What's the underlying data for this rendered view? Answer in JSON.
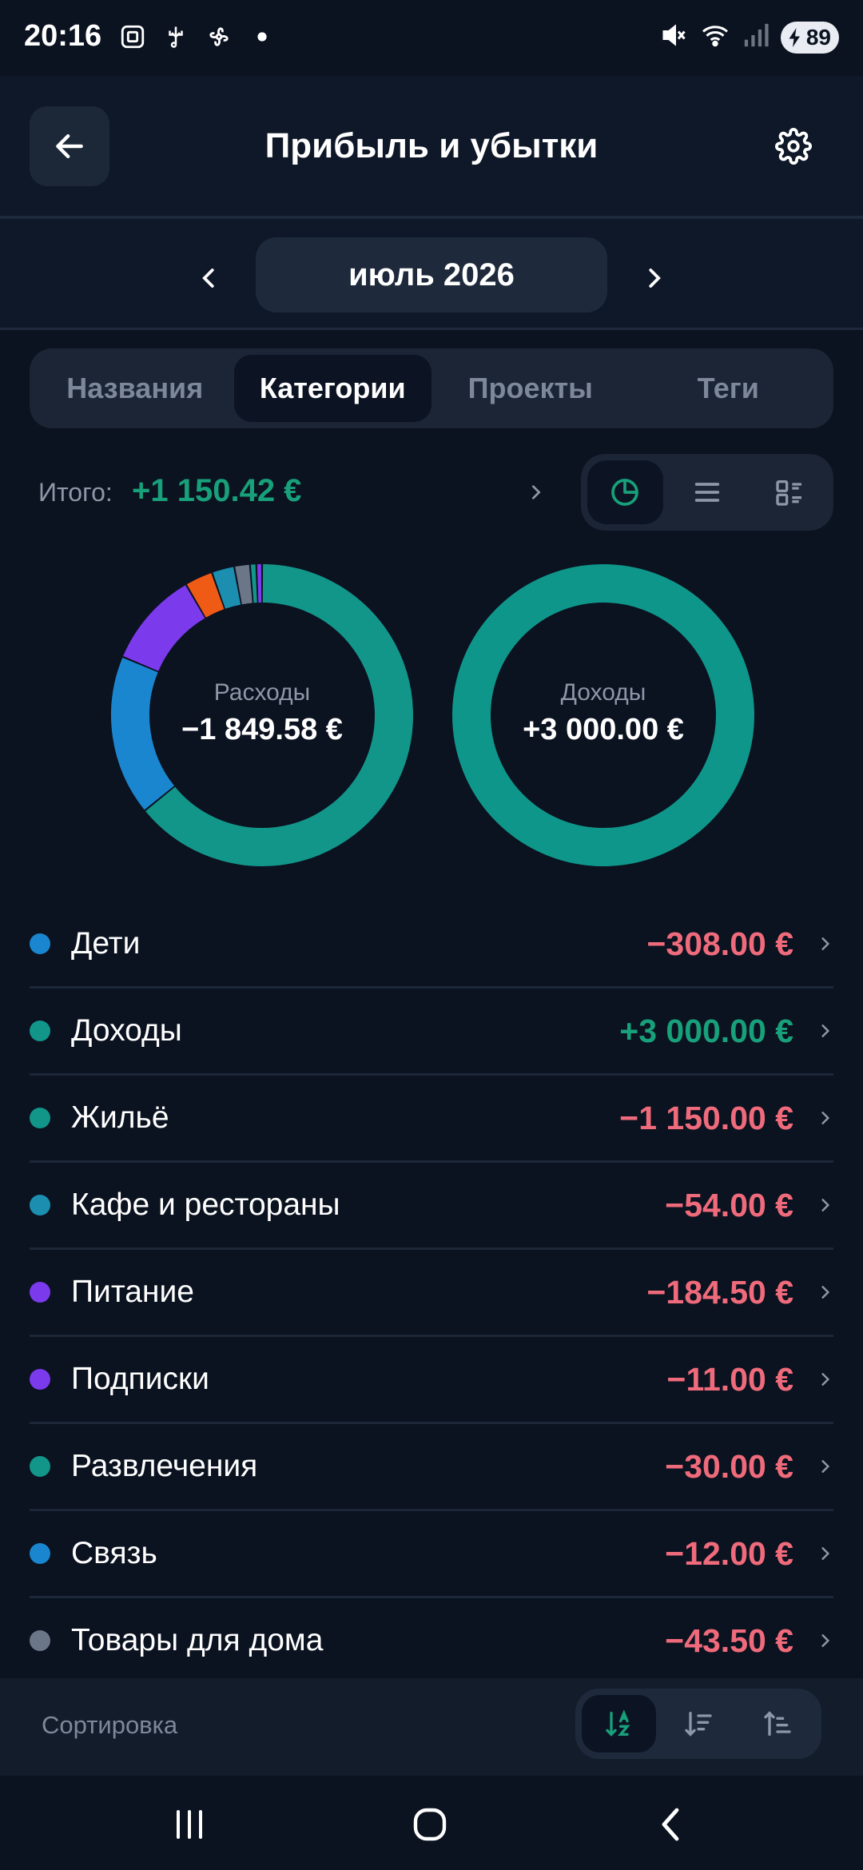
{
  "status_bar": {
    "time": "20:16",
    "battery": "89",
    "icons": [
      "screenshot-icon",
      "usb-icon",
      "fan-icon",
      "dot-icon",
      "mute-icon",
      "wifi-icon",
      "signal-icon",
      "battery-icon"
    ]
  },
  "header": {
    "title": "Прибыль и убытки",
    "back_icon": "arrow-left-icon",
    "settings_icon": "gear-icon"
  },
  "period": {
    "label": "июль 2026"
  },
  "tabs": [
    {
      "label": "Названия",
      "active": false
    },
    {
      "label": "Категории",
      "active": true
    },
    {
      "label": "Проекты",
      "active": false
    },
    {
      "label": "Теги",
      "active": false
    }
  ],
  "total": {
    "label": "Итого:",
    "value": "+1 150.42 €"
  },
  "view_modes": [
    "pie-chart-icon",
    "list-icon",
    "grid-list-icon"
  ],
  "charts": {
    "expenses": {
      "label": "Расходы",
      "value": "−1 849.58 €"
    },
    "income": {
      "label": "Доходы",
      "value": "+3 000.00 €"
    }
  },
  "chart_data": [
    {
      "type": "pie",
      "title": "Расходы",
      "categories": [
        "Жильё",
        "Дети",
        "Питание",
        "Кафе и рестораны",
        "Товары для дома",
        "Развлечения",
        "Связь",
        "Подписки"
      ],
      "values": [
        1150.0,
        308.0,
        184.5,
        54.0,
        43.5,
        30.0,
        12.0,
        11.0
      ],
      "colors": [
        "#12968a",
        "#1a86cf",
        "#7c3aed",
        "#ef5a14",
        "#1c8fb0",
        "#6b7789",
        "#12968a",
        "#7c3aed"
      ]
    },
    {
      "type": "pie",
      "title": "Доходы",
      "categories": [
        "Доходы"
      ],
      "values": [
        3000.0
      ],
      "colors": [
        "#0f968a"
      ]
    }
  ],
  "categories": [
    {
      "name": "Дети",
      "amount": "−308.00 €",
      "sign": "neg",
      "color": "#1a86cf"
    },
    {
      "name": "Доходы",
      "amount": "+3 000.00 €",
      "sign": "pos",
      "color": "#12968a"
    },
    {
      "name": "Жильё",
      "amount": "−1 150.00 €",
      "sign": "neg",
      "color": "#12968a"
    },
    {
      "name": "Кафе и рестораны",
      "amount": "−54.00 €",
      "sign": "neg",
      "color": "#1c8fb0"
    },
    {
      "name": "Питание",
      "amount": "−184.50 €",
      "sign": "neg",
      "color": "#7c3aed"
    },
    {
      "name": "Подписки",
      "amount": "−11.00 €",
      "sign": "neg",
      "color": "#7c3aed"
    },
    {
      "name": "Развлечения",
      "amount": "−30.00 €",
      "sign": "neg",
      "color": "#12968a"
    },
    {
      "name": "Связь",
      "amount": "−12.00 €",
      "sign": "neg",
      "color": "#1a86cf"
    },
    {
      "name": "Товары для дома",
      "amount": "−43.50 €",
      "sign": "neg",
      "color": "#6b7789"
    }
  ],
  "sort": {
    "label": "Сортировка",
    "options": [
      "sort-alpha-icon",
      "sort-desc-icon",
      "sort-asc-icon"
    ]
  },
  "colors": {
    "accent_green": "#18a07a",
    "negative_red": "#ef6b7b",
    "background": "#0b1220"
  }
}
